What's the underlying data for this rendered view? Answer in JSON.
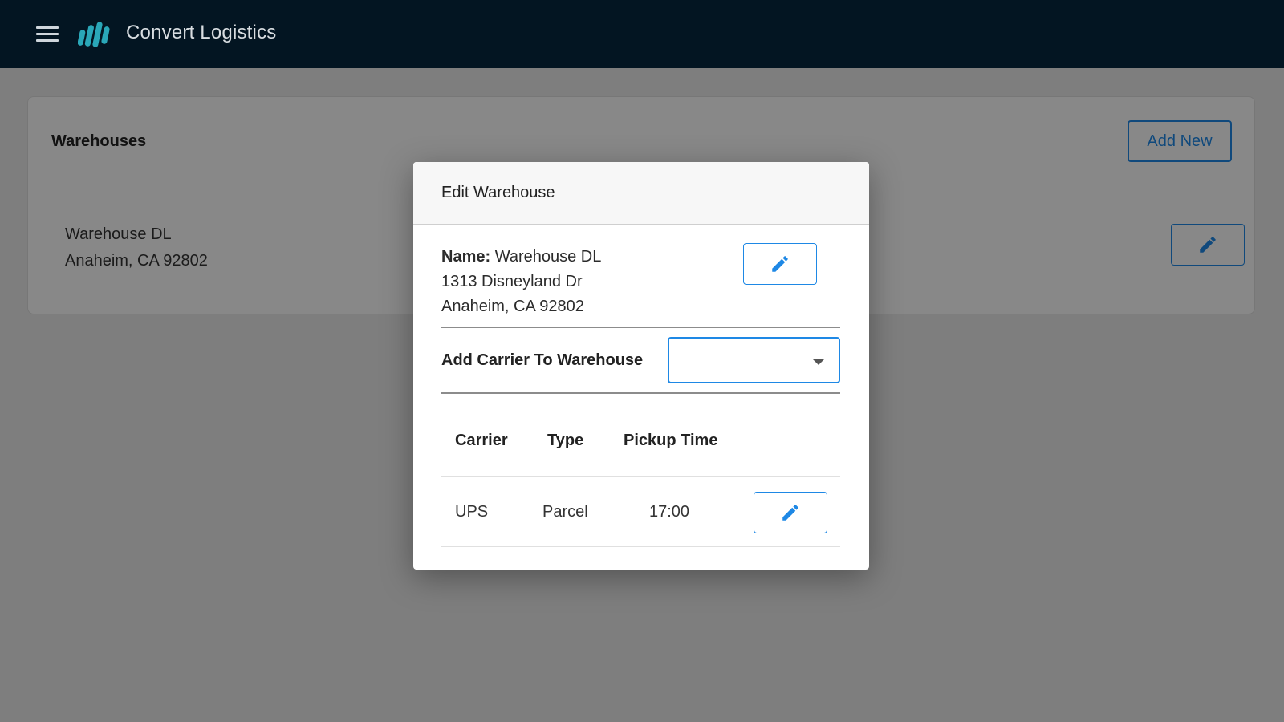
{
  "header": {
    "app_title": "Convert Logistics",
    "menu_icon": "hamburger-menu-icon",
    "logo_icon": "convert-logo-icon"
  },
  "warehouses_card": {
    "title": "Warehouses",
    "add_new_label": "Add New",
    "items": [
      {
        "name": "Warehouse DL",
        "city_line": "Anaheim, CA 92802",
        "edit_icon": "pencil-icon"
      }
    ]
  },
  "modal": {
    "title": "Edit Warehouse",
    "name_label": "Name:",
    "name_value": "Warehouse DL",
    "address_line1": "1313 Disneyland Dr",
    "address_line2": "Anaheim, CA 92802",
    "add_carrier_label": "Add Carrier To Warehouse",
    "carrier_select_value": "",
    "table": {
      "columns": [
        "Carrier",
        "Type",
        "Pickup Time"
      ],
      "rows": [
        {
          "carrier": "UPS",
          "type": "Parcel",
          "pickup_time": "17:00"
        }
      ]
    }
  },
  "colors": {
    "topbar": "#031522",
    "accent": "#1e88e5",
    "logo": "#2aa7b8"
  }
}
